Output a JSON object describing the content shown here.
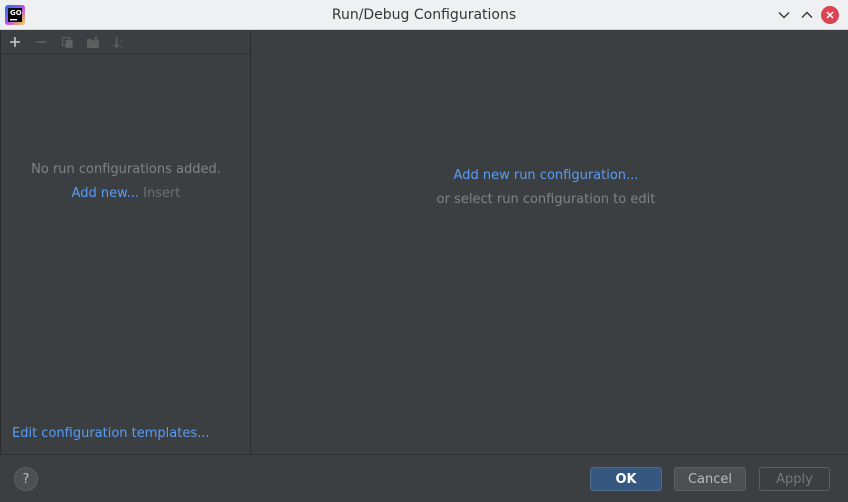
{
  "window": {
    "title": "Run/Debug Configurations",
    "app_icon_label": "GO"
  },
  "toolbar": {
    "icons": [
      "add-icon",
      "remove-icon",
      "copy-icon",
      "new-folder-icon",
      "sort-icon"
    ]
  },
  "left_panel": {
    "empty_message": "No run configurations added.",
    "add_new_label": "Add new...",
    "add_new_shortcut": "Insert",
    "edit_templates_label": "Edit configuration templates..."
  },
  "right_panel": {
    "add_run_config_label": "Add new run configuration...",
    "select_message": "or select run configuration to edit"
  },
  "buttons": {
    "help": "?",
    "ok": "OK",
    "cancel": "Cancel",
    "apply": "Apply"
  },
  "colors": {
    "background": "#3c3f41",
    "link": "#589df6",
    "ok_button": "#365880",
    "close_button": "#da4453"
  }
}
